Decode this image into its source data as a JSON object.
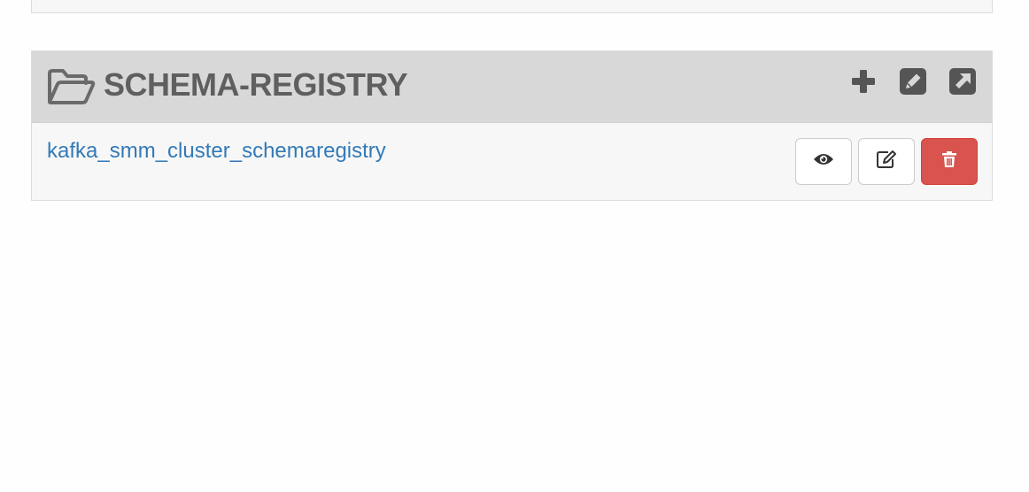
{
  "panel": {
    "title": "SCHEMA-REGISTRY",
    "header_icons": [
      "plus-icon",
      "edit-square-icon",
      "external-link-square-icon"
    ],
    "items": [
      {
        "name": "kafka_smm_cluster_schemaregistry",
        "actions": [
          "eye-icon",
          "edit-icon",
          "trash-icon"
        ]
      }
    ]
  },
  "colors": {
    "header_bg": "#d8d8d8",
    "title_color": "#5f5f5f",
    "link_color": "#337ab7",
    "danger": "#d9534f",
    "panel_bg": "#f7f7f7"
  }
}
